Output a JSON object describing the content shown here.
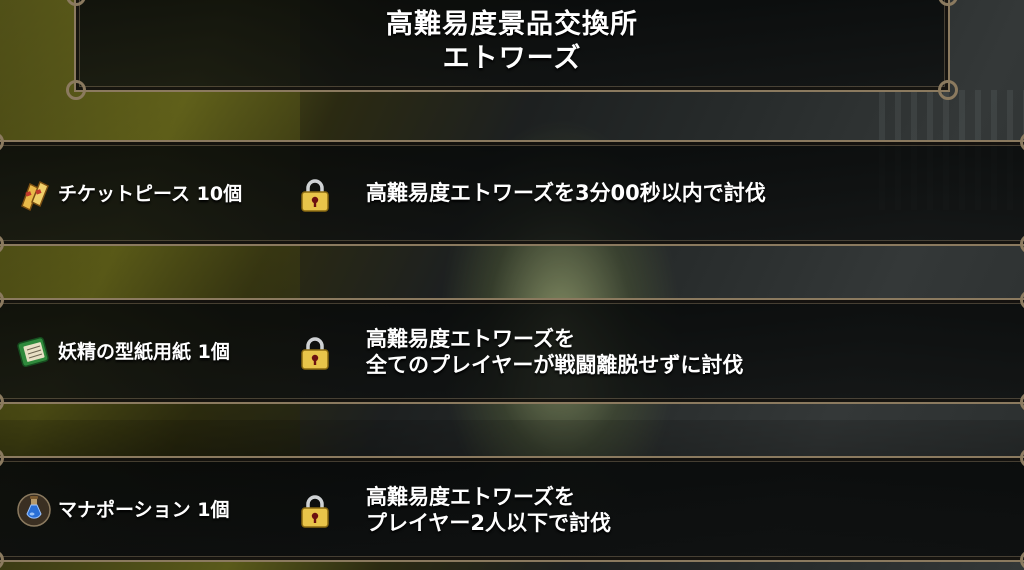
{
  "header": {
    "title_line1": "高難易度景品交換所",
    "title_line2": "エトワーズ"
  },
  "rewards": [
    {
      "item_label": "チケットピース 10個",
      "icon": "ticket-piece-icon",
      "locked": true,
      "condition_line1": "高難易度エトワーズを3分00秒以内で討伐",
      "condition_line2": ""
    },
    {
      "item_label": "妖精の型紙用紙 1個",
      "icon": "pattern-paper-icon",
      "locked": true,
      "condition_line1": "高難易度エトワーズを",
      "condition_line2": "全てのプレイヤーが戦闘離脱せずに討伐"
    },
    {
      "item_label": "マナポーション 1個",
      "icon": "mana-potion-icon",
      "locked": true,
      "condition_line1": "高難易度エトワーズを",
      "condition_line2": "プレイヤー2人以下で討伐"
    }
  ],
  "colors": {
    "frame": "#8b7a5f",
    "lock_gold": "#e8c44a",
    "keyhole": "#6b1010"
  }
}
